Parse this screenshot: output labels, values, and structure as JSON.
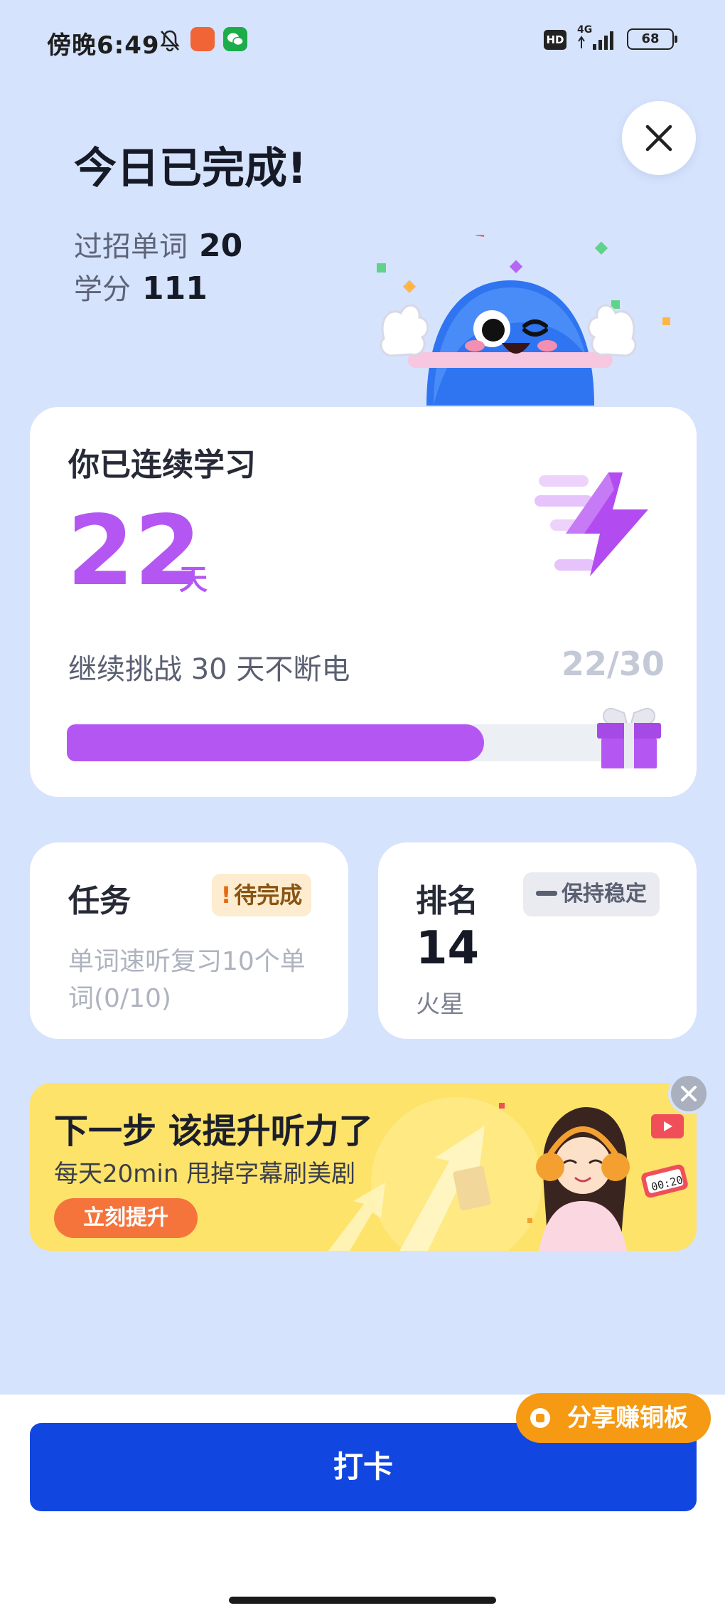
{
  "status_bar": {
    "time": "傍晚6:49",
    "hd_label": "HD",
    "network": "4G",
    "battery": "68"
  },
  "hero": {
    "title": "今日已完成!",
    "words_label": "过招单词",
    "words_value": "20",
    "credits_label": "学分",
    "credits_value": "111"
  },
  "streak": {
    "title": "你已连续学习",
    "days": "22",
    "unit": "天",
    "challenge": "继续挑战 30 天不断电",
    "progress_text": "22/30",
    "progress_fraction": 0.7333,
    "accent_color": "#b457f2"
  },
  "task": {
    "title": "任务",
    "badge_mark": "!",
    "badge": "待完成",
    "description": "单词速听复习10个单词(0/10)"
  },
  "rank": {
    "title": "排名",
    "badge": "保持稳定",
    "number": "14",
    "planet": "火星"
  },
  "banner": {
    "title": "下一步 该提升听力了",
    "subtitle": "每天20min 甩掉字幕刷美剧",
    "button": "立刻提升",
    "video_tag": "00:20"
  },
  "share": {
    "label": "分享赚铜板"
  },
  "checkin": {
    "label": "打卡",
    "color": "#1147e0"
  }
}
